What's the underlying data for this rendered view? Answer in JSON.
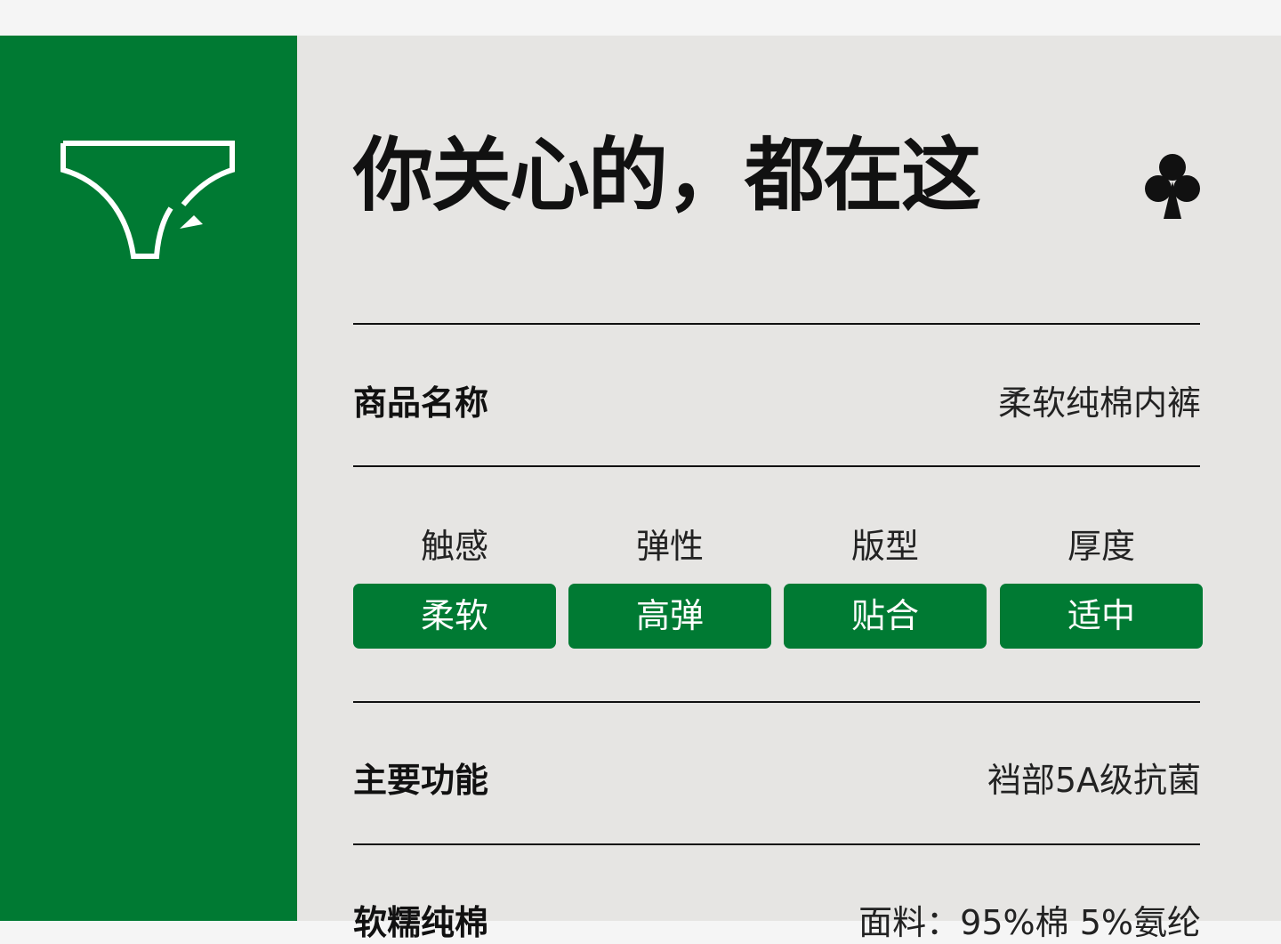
{
  "colors": {
    "brand_green": "#007a33",
    "panel_bg": "#e6e5e3",
    "text": "#111111"
  },
  "sidebar": {
    "icon": "underwear-arrow-icon"
  },
  "header": {
    "title": "你关心的，都在这",
    "icon": "club-suit-icon"
  },
  "product_name": {
    "label": "商品名称",
    "value": "柔软纯棉内裤"
  },
  "attributes": [
    {
      "label": "触感",
      "value": "柔软"
    },
    {
      "label": "弹性",
      "value": "高弹"
    },
    {
      "label": "版型",
      "value": "贴合"
    },
    {
      "label": "厚度",
      "value": "适中"
    }
  ],
  "main_function": {
    "label": "主要功能",
    "value": "裆部5A级抗菌"
  },
  "material": {
    "label": "软糯纯棉",
    "value": "面料：95%棉 5%氨纶"
  }
}
